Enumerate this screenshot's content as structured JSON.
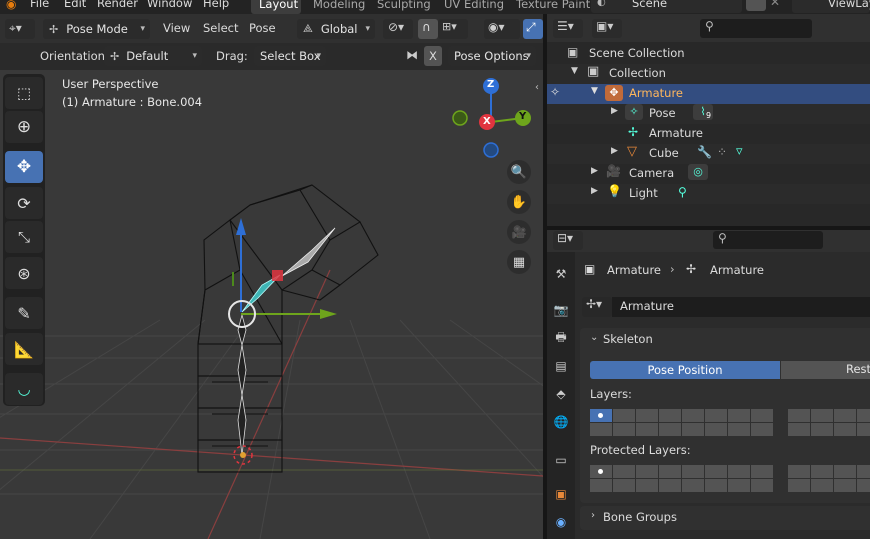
{
  "menubar": {
    "items": [
      "File",
      "Edit",
      "Render",
      "Window",
      "Help"
    ],
    "workspace_tabs": [
      "Layout",
      "Modeling",
      "Sculpting",
      "UV Editing",
      "Texture Paint"
    ],
    "active_tab": "Layout",
    "scene": "Scene",
    "view_layer": "ViewLay"
  },
  "viewport_header": {
    "mode": "Pose Mode",
    "menus": [
      "View",
      "Select",
      "Pose"
    ],
    "transform_orientation": "Global"
  },
  "tool_settings": {
    "orientation_label": "Orientation:",
    "orientation_value": "Default",
    "drag_label": "Drag:",
    "drag_value": "Select Box",
    "x_mirror": "X",
    "pose_options": "Pose Options"
  },
  "viewport": {
    "perspective": "User Perspective",
    "object_info": "(1) Armature : Bone.004",
    "gizmo": {
      "x": "X",
      "y": "Y",
      "z": "Z"
    }
  },
  "outliner": {
    "search_placeholder": "",
    "items": [
      {
        "label": "Scene Collection"
      },
      {
        "label": "Collection"
      },
      {
        "label": "Armature",
        "selected": true
      },
      {
        "label": "Pose",
        "badge": "9"
      },
      {
        "label": "Armature"
      },
      {
        "label": "Cube"
      },
      {
        "label": "Camera"
      },
      {
        "label": "Light"
      }
    ]
  },
  "properties": {
    "breadcrumb": [
      "Armature",
      "Armature"
    ],
    "data_name": "Armature",
    "skeleton_panel": "Skeleton",
    "pose_position": "Pose Position",
    "rest_position": "Rest",
    "layers_label": "Layers:",
    "protected_layers_label": "Protected Layers:",
    "bone_groups_panel": "Bone Groups"
  },
  "colors": {
    "accent": "#4772b3",
    "x_axis": "#e0353f",
    "y_axis": "#6ea51c",
    "z_axis": "#2e6fd6",
    "selected_row": "#334d80"
  }
}
